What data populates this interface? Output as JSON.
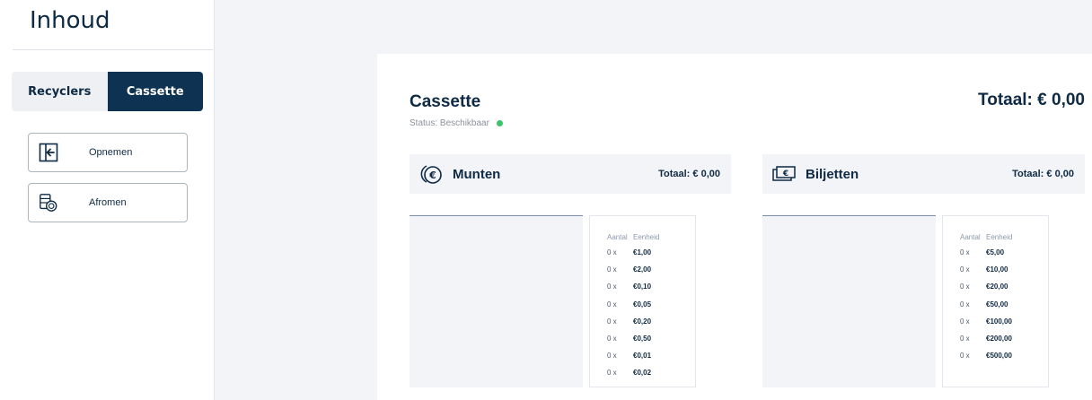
{
  "sidebar": {
    "title": "Inhoud",
    "tabs": [
      {
        "label": "Recyclers",
        "active": false
      },
      {
        "label": "Cassette",
        "active": true
      }
    ],
    "actions": [
      {
        "label": "Opnemen",
        "icon": "enter-arrow-icon"
      },
      {
        "label": "Afromen",
        "icon": "coin-stack-icon"
      }
    ]
  },
  "panel": {
    "title": "Cassette",
    "status_text": "Status: Beschikbaar",
    "total": "Totaal: € 0,00",
    "sections": [
      {
        "title": "Munten",
        "total": "Totaal: € 0,00",
        "icon": "coin-euro-icon",
        "col_qty": "Aantal",
        "col_unit": "Eenheid",
        "rows": [
          {
            "qty": "0 x",
            "unit": "€1,00"
          },
          {
            "qty": "0 x",
            "unit": "€2,00"
          },
          {
            "qty": "0 x",
            "unit": "€0,10"
          },
          {
            "qty": "0 x",
            "unit": "€0,05"
          },
          {
            "qty": "0 x",
            "unit": "€0,20"
          },
          {
            "qty": "0 x",
            "unit": "€0,50"
          },
          {
            "qty": "0 x",
            "unit": "€0,01"
          },
          {
            "qty": "0 x",
            "unit": "€0,02"
          }
        ]
      },
      {
        "title": "Biljetten",
        "total": "Totaal: € 0,00",
        "icon": "banknote-euro-icon",
        "col_qty": "Aantal",
        "col_unit": "Eenheid",
        "rows": [
          {
            "qty": "0 x",
            "unit": "€5,00"
          },
          {
            "qty": "0 x",
            "unit": "€10,00"
          },
          {
            "qty": "0 x",
            "unit": "€20,00"
          },
          {
            "qty": "0 x",
            "unit": "€50,00"
          },
          {
            "qty": "0 x",
            "unit": "€100,00"
          },
          {
            "qty": "0 x",
            "unit": "€200,00"
          },
          {
            "qty": "0 x",
            "unit": "€500,00"
          }
        ]
      }
    ]
  },
  "colors": {
    "primary": "#0e3352",
    "status_available": "#3ac56a",
    "background": "#f3f4f7"
  }
}
